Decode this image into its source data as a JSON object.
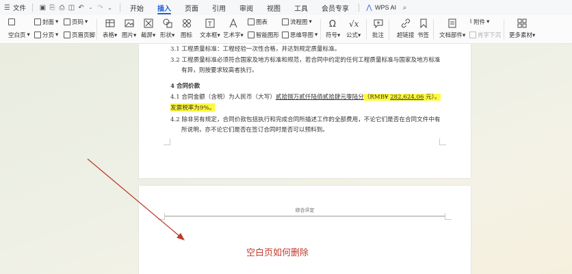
{
  "menubar": {
    "menu_label": "文件",
    "tabs": [
      "开始",
      "插入",
      "页面",
      "引用",
      "审阅",
      "视图",
      "工具",
      "会员专享"
    ],
    "active_tab": "插入",
    "wps_ai": "WPS AI"
  },
  "ribbon": {
    "blank_page": "空白页",
    "page_break": "分页",
    "cover": "封面",
    "page_number": "页码",
    "header_footer": "页眉页脚",
    "table": "表格",
    "picture": "图片",
    "screenshot": "截屏",
    "shape": "形状",
    "icon": "图标",
    "textbox": "文本框",
    "art_text": "艺术字",
    "chart": "图表",
    "smart_art": "智能图形",
    "flowchart": "流程图",
    "mindmap": "思维导图",
    "symbol": "符号",
    "formula": "公式",
    "comment": "批注",
    "hyperlink": "超链接",
    "bookmark": "书签",
    "attachment": "附件",
    "inline_download": "肖字下沉",
    "document_parts": "文档部件",
    "more": "更多素材"
  },
  "document": {
    "line1": "3.1 工程质量标准：工程经验一次性合格，并达到规定质量标准。",
    "line2": "3.2 工程质量标准必须符合国家及地方标准和规范，若合同中约定的任何工程质量标准与国家及地方标准",
    "line3": "有异，则按要求较高者执行。",
    "section_title": "4 合同价款",
    "line5_a": "4.1 合同金额（含税）为人民币（大写）",
    "line5_b": "贰拾捌万贰仟陆佰贰拾肆元零陆分",
    "line5_c": "（RMB¥",
    "line5_d": "282,624.06",
    "line5_e": "元）。",
    "line6": "发票税率为9%。",
    "line7": "4.2 除非另有规定，合同价款包括执行和完成合同所描述工作的全部费用，不论它们是否在合同文件中有",
    "line8": "所说明，亦不论它们是否在签订合同时是否可以预料到。",
    "page2_header": "综合评定"
  },
  "caption": "空白页如何删除",
  "colors": {
    "accent": "#1a5fd6",
    "highlight": "#fef93a",
    "caption": "#c0392b",
    "arrow": "#c0392b"
  }
}
